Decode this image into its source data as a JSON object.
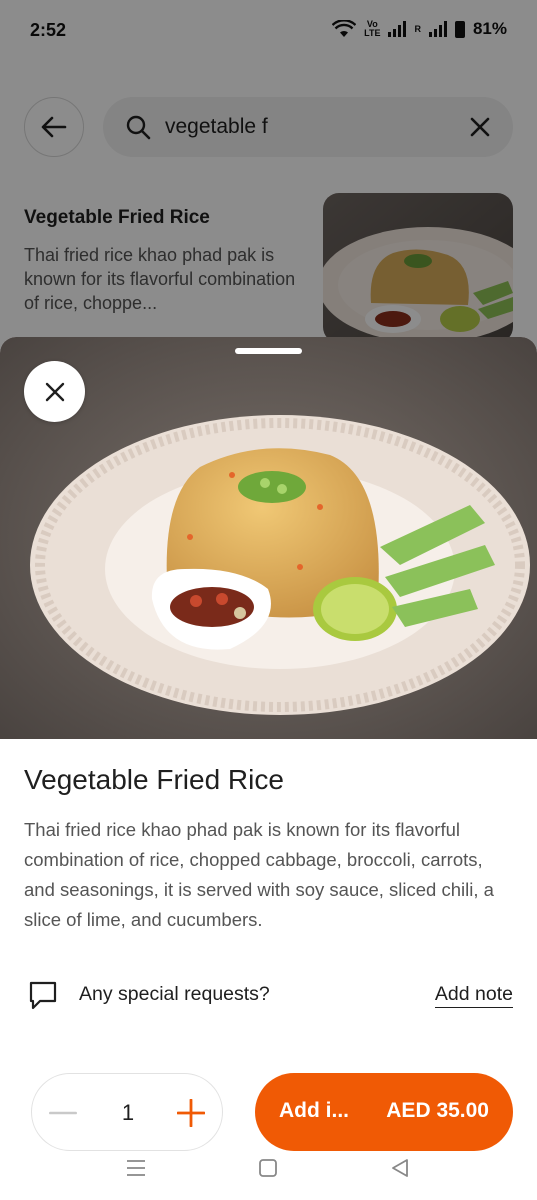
{
  "status_bar": {
    "time": "2:52",
    "volte_top": "Vo",
    "volte_bottom": "LTE",
    "roaming": "R",
    "battery": "81%"
  },
  "search": {
    "value": "vegetable f"
  },
  "result": {
    "title": "Vegetable Fried Rice",
    "description": "Thai fried rice khao phad pak is known for its flavorful combination of rice, choppe..."
  },
  "item": {
    "title": "Vegetable Fried Rice",
    "description": "Thai fried rice khao phad pak is known for its flavorful combination of rice, chopped cabbage, broccoli, carrots, and seasonings, it is served with soy sauce, sliced chili, a slice of lime, and cucumbers."
  },
  "special_requests": {
    "label": "Any special requests?",
    "link": "Add note"
  },
  "quantity": {
    "value": "1"
  },
  "add_button": {
    "label": "Add i...",
    "price": "AED 35.00"
  },
  "colors": {
    "accent": "#f05a05",
    "scrim": "rgba(0,0,0,0.45)"
  },
  "icons": {
    "back": "arrow-left-icon",
    "search": "search-icon",
    "clear": "close-icon",
    "close_sheet": "close-icon",
    "note": "chat-bubble-icon",
    "minus": "minus-icon",
    "plus": "plus-icon"
  }
}
